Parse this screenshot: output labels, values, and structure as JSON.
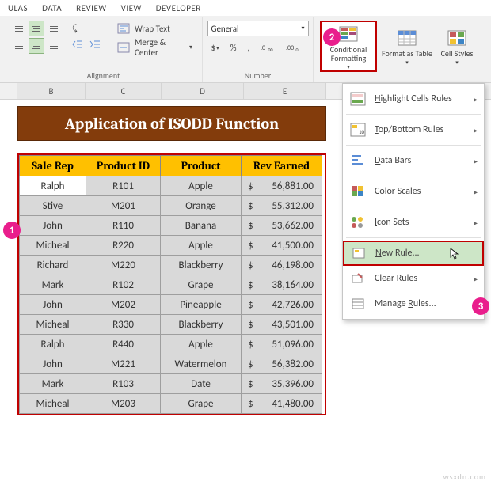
{
  "ribbon": {
    "tabs": [
      "ULAS",
      "DATA",
      "REVIEW",
      "VIEW",
      "DEVELOPER"
    ],
    "wrap_text": "Wrap Text",
    "merge_center": "Merge & Center",
    "alignment_label": "Alignment",
    "number_format": "General",
    "number_label": "Number",
    "currency_symbol": "$",
    "percent": "%",
    "comma": ",",
    "dec_inc": ".0→.00",
    "dec_dec": ".00→.0",
    "conditional_formatting": "Conditional Formatting",
    "format_as_table": "Format as Table",
    "cell_styles": "Cell Styles"
  },
  "columns": [
    "B",
    "C",
    "D",
    "E"
  ],
  "title": "Application of ISODD Function",
  "headers": [
    "Sale Rep",
    "Product ID",
    "Product",
    "Rev Earned"
  ],
  "rows": [
    {
      "rep": "Ralph",
      "pid": "R101",
      "prod": "Apple",
      "rev": "56,881.00"
    },
    {
      "rep": "Stive",
      "pid": "M201",
      "prod": "Orange",
      "rev": "55,312.00"
    },
    {
      "rep": "John",
      "pid": "R110",
      "prod": "Banana",
      "rev": "53,662.00"
    },
    {
      "rep": "Micheal",
      "pid": "R220",
      "prod": "Apple",
      "rev": "41,500.00"
    },
    {
      "rep": "Richard",
      "pid": "M220",
      "prod": "Blackberry",
      "rev": "46,198.00"
    },
    {
      "rep": "Mark",
      "pid": "R102",
      "prod": "Grape",
      "rev": "38,164.00"
    },
    {
      "rep": "John",
      "pid": "M202",
      "prod": "Pineapple",
      "rev": "42,726.00"
    },
    {
      "rep": "Micheal",
      "pid": "R330",
      "prod": "Blackberry",
      "rev": "43,501.00"
    },
    {
      "rep": "Ralph",
      "pid": "R440",
      "prod": "Apple",
      "rev": "51,096.00"
    },
    {
      "rep": "John",
      "pid": "M221",
      "prod": "Watermelon",
      "rev": "56,382.00"
    },
    {
      "rep": "Mark",
      "pid": "R103",
      "prod": "Date",
      "rev": "35,396.00"
    },
    {
      "rep": "Micheal",
      "pid": "M203",
      "prod": "Grape",
      "rev": "41,480.00"
    }
  ],
  "cf_menu": {
    "highlight": "Highlight Cells Rules",
    "topbottom": "Top/Bottom Rules",
    "databars": "Data Bars",
    "colorscales": "Color Scales",
    "iconsets": "Icon Sets",
    "newrule": "New Rule...",
    "clearrules": "Clear Rules",
    "managerules": "Manage Rules..."
  },
  "callouts": {
    "one": "1",
    "two": "2",
    "three": "3"
  },
  "watermark": "wsxdn.com",
  "chevron": "▾",
  "subarrow": "▸",
  "dollar": "$"
}
